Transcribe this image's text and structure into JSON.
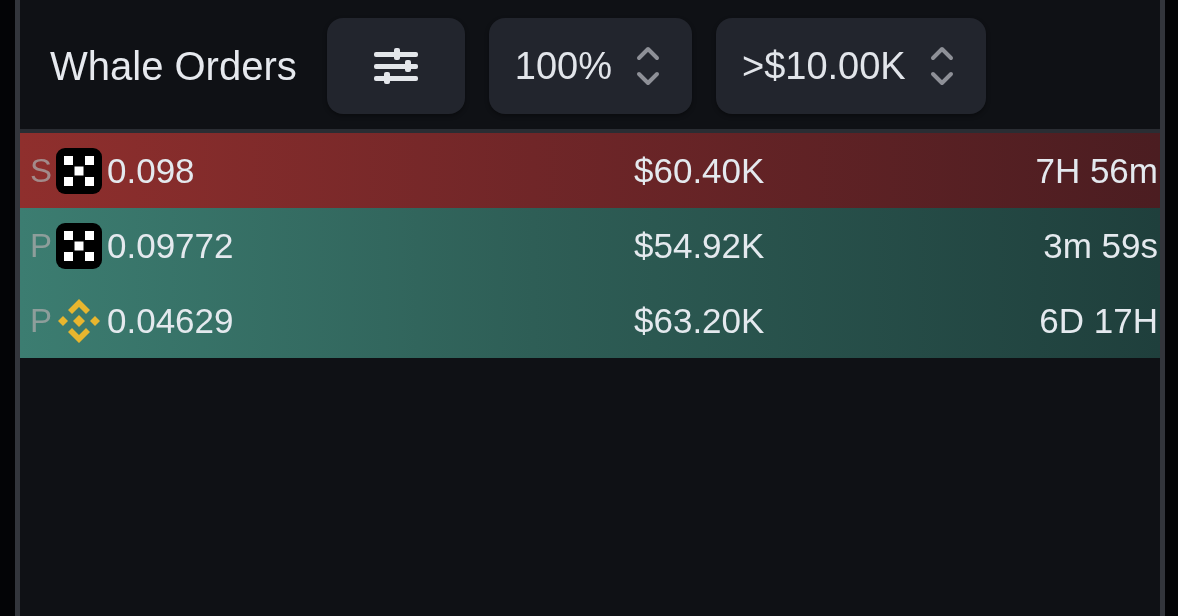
{
  "panel": {
    "title": "Whale Orders"
  },
  "filters": [
    {
      "value": "100%"
    },
    {
      "value": ">$10.00K"
    }
  ],
  "orders": [
    {
      "market": "S",
      "kind": "sell",
      "logo": {
        "kind": "checker"
      },
      "price": "0.098",
      "amount": "$60.40K",
      "age": "7H 56m"
    },
    {
      "market": "P",
      "kind": "buy",
      "logo": {
        "kind": "checker"
      },
      "price": "0.09772",
      "amount": "$54.92K",
      "age": "3m 59s"
    },
    {
      "market": "P",
      "kind": "buy",
      "logo": {
        "kind": "diamond"
      },
      "price": "0.04629",
      "amount": "$63.20K",
      "age": "6D 17H"
    }
  ]
}
